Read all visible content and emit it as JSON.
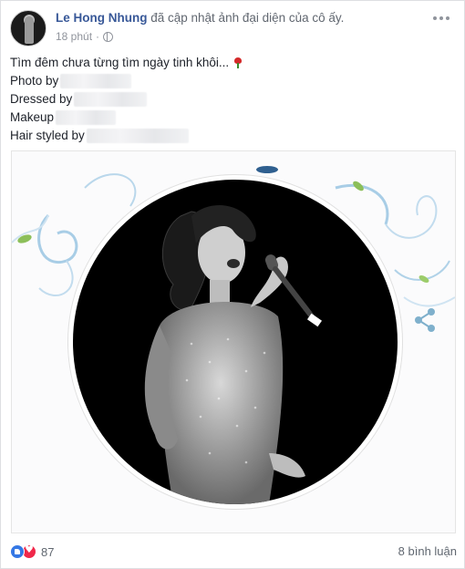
{
  "post": {
    "author": "Le Hong Nhung",
    "action_text": "đã cập nhật ảnh đại diện của cô ấy.",
    "time": "18 phút",
    "time_separator": "·",
    "privacy_icon": "globe-icon",
    "menu_icon": "more-options-icon"
  },
  "caption": {
    "line1": "Tìm đêm chưa từng tìm ngày tinh khôi...",
    "emoji": "rose-emoji",
    "credits": [
      {
        "label": "Photo by"
      },
      {
        "label": "Dressed by"
      },
      {
        "label": "Makeup"
      },
      {
        "label": "Hair styled by"
      }
    ]
  },
  "photo": {
    "description_icon": "share-icon",
    "colors": {
      "circle": "#000000",
      "ribbon": "#7fb6d8",
      "leaf": "#8cbf5a"
    }
  },
  "footer": {
    "reaction_icons": [
      "like-icon",
      "love-icon"
    ],
    "reaction_count": "87",
    "comments": "8 bình luận"
  },
  "colors": {
    "author": "#385898",
    "meta": "#90949c",
    "text": "#1d2129"
  }
}
